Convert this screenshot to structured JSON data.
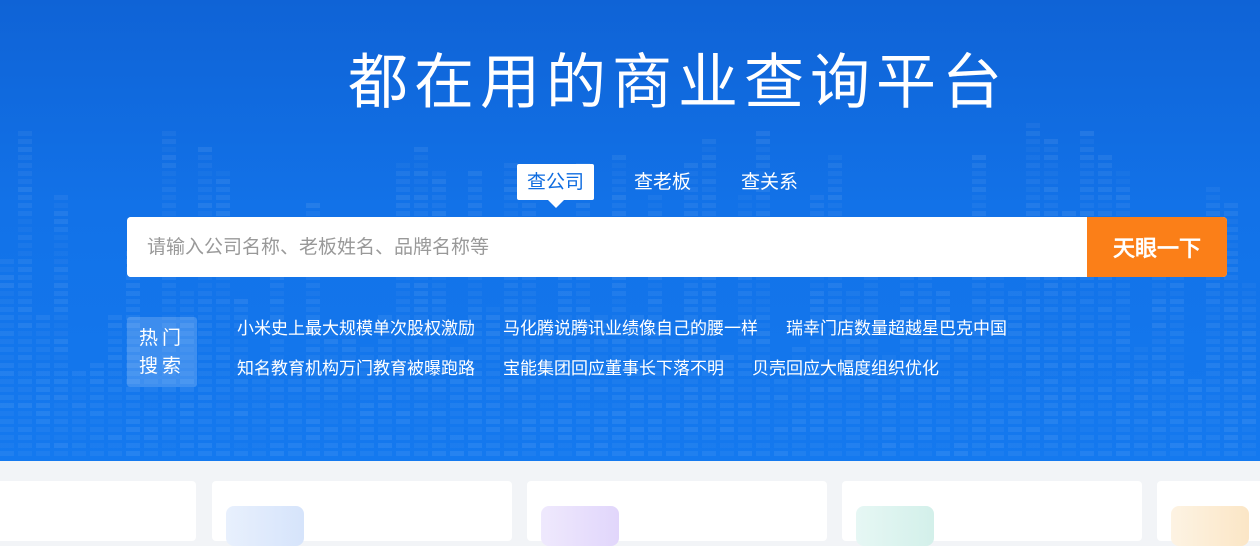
{
  "hero": {
    "title": "都在用的商业查询平台"
  },
  "tabs": [
    {
      "label": "查公司",
      "active": true
    },
    {
      "label": "查老板",
      "active": false
    },
    {
      "label": "查关系",
      "active": false
    }
  ],
  "search": {
    "placeholder": "请输入公司名称、老板姓名、品牌名称等",
    "value": "",
    "button_label": "天眼一下"
  },
  "hot": {
    "badge_line1": "热门",
    "badge_line2": "搜索",
    "rows": [
      [
        "小米史上最大规模单次股权激励",
        "马化腾说腾讯业绩像自己的腰一样",
        "瑞幸门店数量超越星巴克中国"
      ],
      [
        "知名教育机构万门教育被曝跑路",
        "宝能集团回应董事长下落不明",
        "贝壳回应大幅度组织优化"
      ]
    ]
  },
  "colors": {
    "hero_blue": "#1272e8",
    "accent_orange": "#fb7f18",
    "tab_active_text": "#0f6ce0"
  }
}
